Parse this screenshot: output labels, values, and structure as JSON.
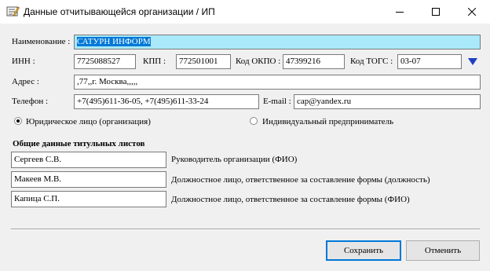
{
  "window": {
    "title": "Данные отчитывающейся организации / ИП",
    "icons": {
      "app": "form-edit-icon",
      "minimize": "minimize-icon",
      "maximize": "maximize-icon",
      "close": "close-icon"
    }
  },
  "form": {
    "name": {
      "label": "Наименование :",
      "value": "САТУРН ИНФОРМ"
    },
    "inn": {
      "label": "ИНН :",
      "value": "7725088527"
    },
    "kpp": {
      "label": "КПП :",
      "value": "772501001"
    },
    "okpo": {
      "label": "Код ОКПО :",
      "value": "47399216"
    },
    "togs": {
      "label": "Код ТОГС :",
      "value": "03-07",
      "button_icon": "dropdown-triangle-icon"
    },
    "address": {
      "label": "Адрес :",
      "value": ",77,,г. Москва,,,,,"
    },
    "phone": {
      "label": "Телефон :",
      "value": "+7(495)611-36-05, +7(495)611-33-24"
    },
    "email": {
      "label": "E-mail :",
      "value": "cap@yandex.ru"
    },
    "entity_type": {
      "legal": "Юридическое лицо (организация)",
      "individual": "Индивидуальный предприниматель",
      "selected": "legal"
    }
  },
  "title_pages": {
    "heading": "Общие данные титульных листов",
    "rows": [
      {
        "value": "Сергеев С.В.",
        "label": "Руководитель организации (ФИО)"
      },
      {
        "value": "Макеев М.В.",
        "label": "Должностное лицо, ответственное за составление формы (должность)"
      },
      {
        "value": "Капица С.П.",
        "label": "Должностное лицо, ответственное за составление формы (ФИО)"
      }
    ]
  },
  "buttons": {
    "save": "Сохранить",
    "cancel": "Отменить"
  },
  "colors": {
    "selected_field_bg": "#a9e9f9",
    "text_selection": "#0078d7",
    "dropdown_triangle": "#1f3fbf"
  }
}
